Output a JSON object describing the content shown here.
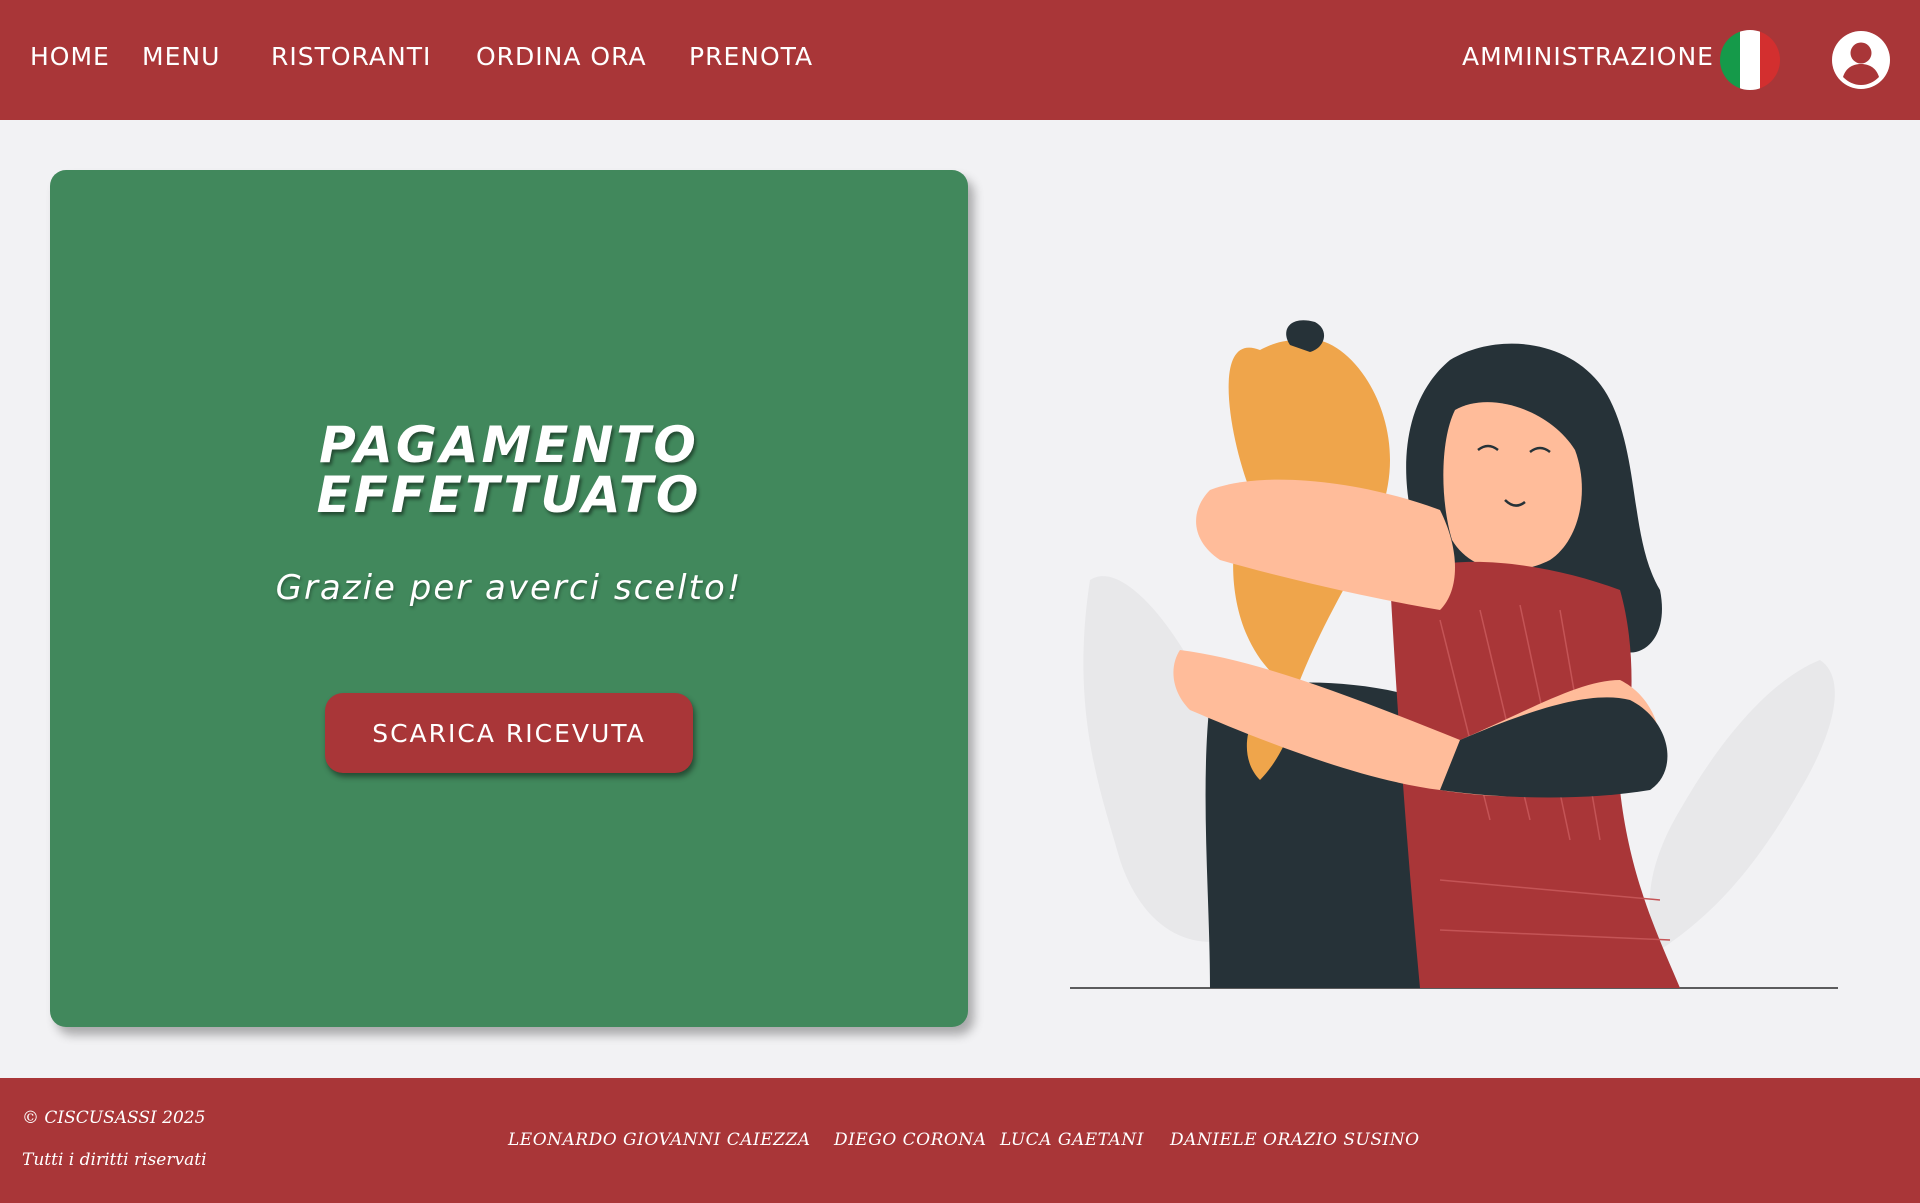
{
  "nav": {
    "home": "HOME",
    "menu": "MENU",
    "ristoranti": "RISTORANTI",
    "ordina": "ORDINA ORA",
    "prenota": "PRENOTA",
    "amministrazione": "AMMINISTRAZIONE"
  },
  "icons": {
    "language": "italian-flag-icon",
    "profile": "user-circle-icon"
  },
  "flag_colors": [
    "#159a4a",
    "#ffffff",
    "#d32f2f"
  ],
  "card": {
    "title_line1": "PAGAMENTO",
    "title_line2": "EFFETTUATO",
    "subtitle": "Grazie per averci scelto!",
    "button_label": "SCARICA RICEVUTA"
  },
  "footer": {
    "copyright": "© CISCUSASSI 2025",
    "rights": "Tutti i diritti riservati",
    "credits": [
      "LEONARDO GIOVANNI CAIEZZA",
      "DIEGO CORONA",
      "LUCA GAETANI",
      "DANIELE ORAZIO SUSINO"
    ]
  },
  "colors": {
    "brand_red": "#a93638",
    "card_green": "#41885c",
    "background": "#f2f2f4"
  }
}
